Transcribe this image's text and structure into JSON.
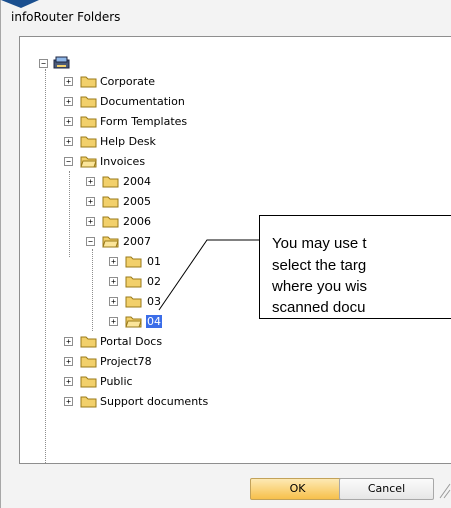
{
  "window": {
    "title": "infoRouter Folders"
  },
  "tree": {
    "folders": [
      {
        "label": "Corporate"
      },
      {
        "label": "Documentation"
      },
      {
        "label": "Form Templates"
      },
      {
        "label": "Help Desk"
      },
      {
        "label": "Invoices"
      },
      {
        "label": "2004"
      },
      {
        "label": "2005"
      },
      {
        "label": "2006"
      },
      {
        "label": "2007"
      },
      {
        "label": "01"
      },
      {
        "label": "02"
      },
      {
        "label": "03"
      },
      {
        "label": "04"
      },
      {
        "label": "Portal Docs"
      },
      {
        "label": "Project78"
      },
      {
        "label": "Public"
      },
      {
        "label": "Support documents"
      }
    ]
  },
  "callout": {
    "lines": [
      "You may use t",
      "select the targ",
      "where you wis",
      "scanned docu"
    ]
  },
  "buttons": {
    "ok_label": "OK",
    "cancel_label": "Cancel"
  },
  "colors": {
    "selection": "#3b6de8",
    "button_accent": "#f7c04b",
    "folder": "#f2d06b"
  }
}
